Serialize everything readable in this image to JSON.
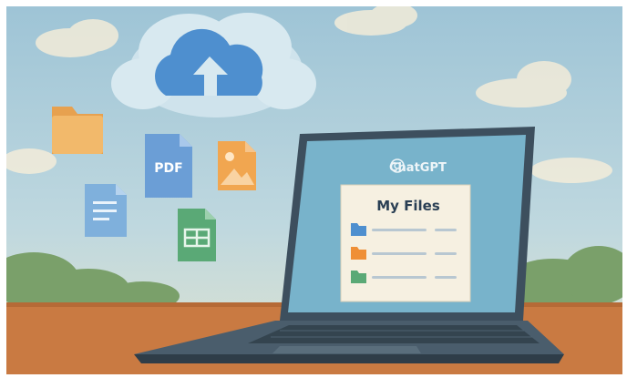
{
  "pdf_icon": {
    "label": "PDF"
  },
  "laptop_screen": {
    "brand_name": "ChatGPT",
    "files_panel": {
      "title": "My Files",
      "items": [
        {
          "icon": "blue-folder-icon"
        },
        {
          "icon": "orange-folder-icon"
        },
        {
          "icon": "green-folder-icon"
        }
      ]
    }
  },
  "colors": {
    "sky": "#a9cbd9",
    "cloud": "#cfe3ec",
    "cloud_arrow": "#4e8fcf",
    "folder": "#f2b96b",
    "pdf": "#6b9ed6",
    "image_file": "#f1a650",
    "doc_file": "#7fb0dc",
    "sheet_file": "#5aa976",
    "screen": "#78b3cb",
    "laptop_body": "#3d4f5e",
    "desk": "#c97a42"
  }
}
